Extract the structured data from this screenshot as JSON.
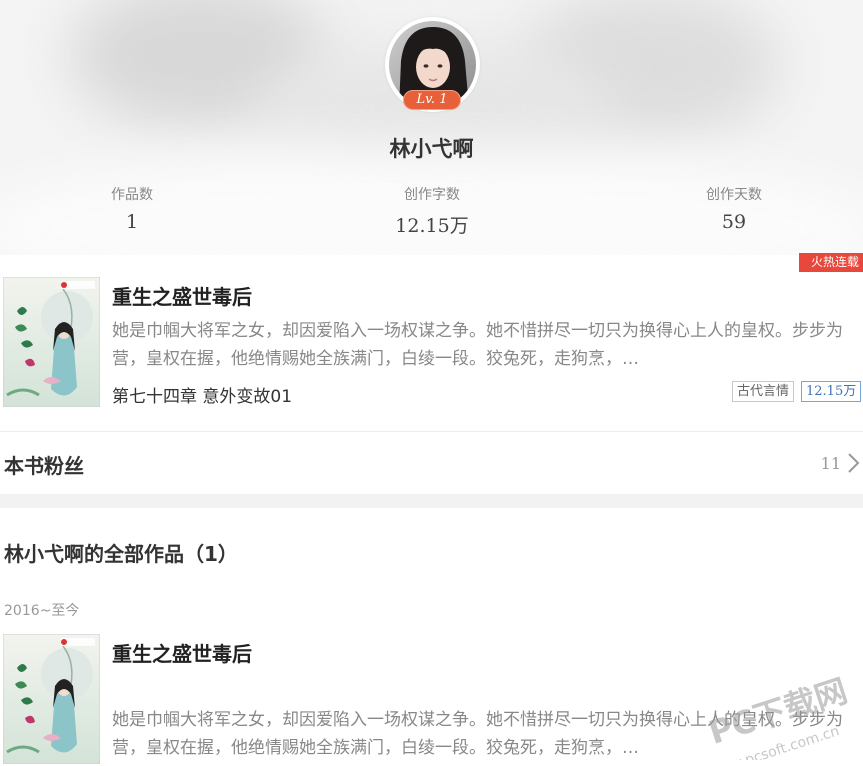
{
  "profile": {
    "author_name": "林小弋啊",
    "level": "Lv. 1",
    "stats": [
      {
        "label": "作品数",
        "value": "1"
      },
      {
        "label": "创作字数",
        "value": "12.15万"
      },
      {
        "label": "创作天数",
        "value": "59"
      }
    ]
  },
  "featured_book": {
    "badge": "火热连载",
    "title": "重生之盛世毒后",
    "description": "她是巾帼大将军之女，却因爱陷入一场权谋之争。她不惜拼尽一切只为换得心上人的皇权。步步为营，皇权在握，他绝情赐她全族满门，白绫一段。狡兔死，走狗烹，…",
    "latest_chapter": "第七十四章  意外变故01",
    "genre": "古代言情",
    "word_count": "12.15万"
  },
  "fans": {
    "label": "本书粉丝",
    "count": "11"
  },
  "all_works": {
    "title": "林小弋啊的全部作品（1）",
    "period": "2016~至今",
    "books": [
      {
        "title": "重生之盛世毒后",
        "description": "她是巾帼大将军之女，却因爱陷入一场权谋之争。她不惜拼尽一切只为换得心上人的皇权。步步为营，皇权在握，他绝情赐她全族满门，白绫一段。狡兔死，走狗烹，…"
      }
    ]
  },
  "watermark": {
    "line1": "PC下载网",
    "line2": "www.pcsoft.com.cn"
  },
  "colors": {
    "hot_badge": "#e8473b",
    "level_badge": "#e8603a",
    "word_tag": "#3f72b5"
  }
}
